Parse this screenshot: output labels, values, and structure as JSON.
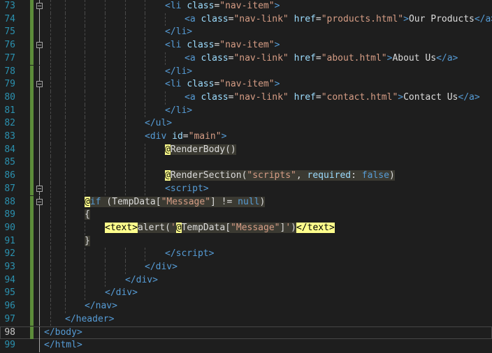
{
  "editor": {
    "current_line": 98,
    "lines": [
      {
        "num": "73",
        "html": "<span class=\"tag\">&lt;li</span> <span class=\"attr\">class</span><span class=\"txt\">=</span><span class=\"str\">\"nav-item\"</span><span class=\"tag\">&gt;</span>"
      },
      {
        "num": "74",
        "html": "<span class=\"tag\">&lt;a</span> <span class=\"attr\">class</span><span class=\"txt\">=</span><span class=\"str\">\"nav-link\"</span> <span class=\"attr\">href</span><span class=\"txt\">=</span><span class=\"str\">\"products.html\"</span><span class=\"tag\">&gt;</span><span class=\"txt\">Our Products</span><span class=\"tag\">&lt;/a&gt;</span>"
      },
      {
        "num": "75",
        "html": "<span class=\"tag\">&lt;/li&gt;</span>"
      },
      {
        "num": "76",
        "html": "<span class=\"tag\">&lt;li</span> <span class=\"attr\">class</span><span class=\"txt\">=</span><span class=\"str\">\"nav-item\"</span><span class=\"tag\">&gt;</span>"
      },
      {
        "num": "77",
        "html": "<span class=\"tag\">&lt;a</span> <span class=\"attr\">class</span><span class=\"txt\">=</span><span class=\"str\">\"nav-link\"</span> <span class=\"attr\">href</span><span class=\"txt\">=</span><span class=\"str\">\"about.html\"</span><span class=\"tag\">&gt;</span><span class=\"txt\">About Us</span><span class=\"tag\">&lt;/a&gt;</span>"
      },
      {
        "num": "78",
        "html": "<span class=\"tag\">&lt;/li&gt;</span>"
      },
      {
        "num": "79",
        "html": "<span class=\"tag\">&lt;li</span> <span class=\"attr\">class</span><span class=\"txt\">=</span><span class=\"str\">\"nav-item\"</span><span class=\"tag\">&gt;</span>"
      },
      {
        "num": "80",
        "html": "<span class=\"tag\">&lt;a</span> <span class=\"attr\">class</span><span class=\"txt\">=</span><span class=\"str\">\"nav-link\"</span> <span class=\"attr\">href</span><span class=\"txt\">=</span><span class=\"str\">\"contact.html\"</span><span class=\"tag\">&gt;</span><span class=\"txt\">Contact Us</span><span class=\"tag\">&lt;/a&gt;</span>"
      },
      {
        "num": "81",
        "html": "<span class=\"tag\">&lt;/li&gt;</span>"
      },
      {
        "num": "82",
        "html": "<span class=\"tag\">&lt;/ul&gt;</span>"
      },
      {
        "num": "83",
        "html": "<span class=\"tag\">&lt;div</span> <span class=\"attr\">id</span><span class=\"txt\">=</span><span class=\"str\">\"main\"</span><span class=\"tag\">&gt;</span>"
      },
      {
        "num": "84",
        "html": "<span class=\"razor-at\">@</span><span class=\"razor\">RenderBody()</span>"
      },
      {
        "num": "85",
        "html": ""
      },
      {
        "num": "86",
        "html": "<span class=\"razor-at\">@</span><span class=\"razor\">RenderSection(<span class=\"str\">\"scripts\"</span>, <span class=\"kw2\">required</span>: <span class=\"kw\">false</span>)</span>"
      },
      {
        "num": "87",
        "html": "<span class=\"tag\">&lt;script&gt;</span>"
      },
      {
        "num": "88",
        "html": "<span class=\"razor-at\">@</span><span class=\"razor\"><span class=\"kw\">if</span> (TempData[<span class=\"str\">\"Message\"</span>] != <span class=\"kw\">null</span>)</span>"
      },
      {
        "num": "89",
        "html": "<span class=\"razor\">{</span>"
      },
      {
        "num": "90",
        "html": "<span class=\"razor-at\">&lt;text&gt;</span><span class=\"razor\">alert(<span class=\"str\">'</span></span><span class=\"razor-at\">@</span><span class=\"razor\">TempData[<span class=\"str\">\"Message\"</span>]<span class=\"str\">'</span>)</span><span class=\"razor-at\">&lt;/text&gt;</span>"
      },
      {
        "num": "91",
        "html": "<span class=\"razor\">}</span>"
      },
      {
        "num": "92",
        "html": "<span class=\"tag\">&lt;/script&gt;</span>"
      },
      {
        "num": "93",
        "html": "<span class=\"tag\">&lt;/div&gt;</span>"
      },
      {
        "num": "94",
        "html": "<span class=\"tag\">&lt;/div&gt;</span>"
      },
      {
        "num": "95",
        "html": "<span class=\"tag\">&lt;/div&gt;</span>"
      },
      {
        "num": "96",
        "html": "<span class=\"tag\">&lt;/nav&gt;</span>"
      },
      {
        "num": "97",
        "html": "<span class=\"tag\">&lt;/header&gt;</span>"
      },
      {
        "num": "98",
        "html": "<span class=\"tag\">&lt;/body&gt;</span>"
      },
      {
        "num": "99",
        "html": "<span class=\"tag\">&lt;/html&gt;</span>"
      }
    ]
  }
}
